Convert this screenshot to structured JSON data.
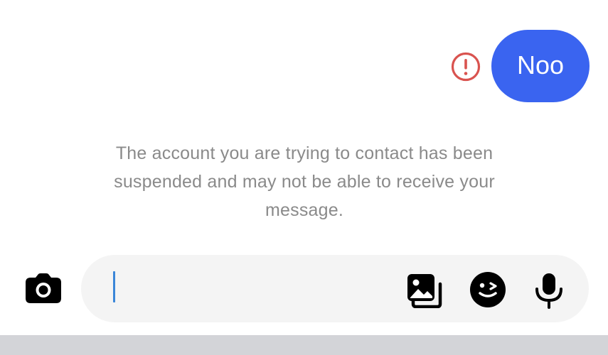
{
  "message": {
    "text": "Noo",
    "status_icon": "exclamation-circle-icon",
    "bubble_color": "#3a64f0",
    "error_color": "#d9534f"
  },
  "notice": {
    "text": "The account you are trying to contact has been suspended and may not be able to receive your message."
  },
  "composer": {
    "value": "",
    "caret_color": "#3a86d8",
    "icons": {
      "camera": "camera-icon",
      "gallery": "gallery-icon",
      "sticker": "sticker-icon",
      "mic": "microphone-icon"
    }
  }
}
